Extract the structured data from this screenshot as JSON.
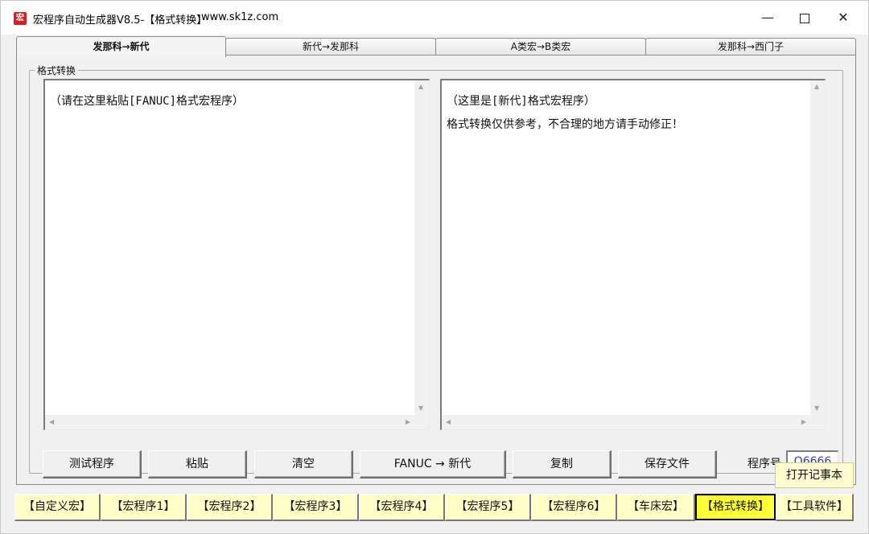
{
  "window": {
    "icon_glyph": "宏",
    "title": "宏程序自动生成器V8.5-【格式转换】",
    "site": "www.sk1z.com",
    "min_glyph": "—",
    "close_glyph": "✕"
  },
  "tabs": [
    {
      "label": "发那科→新代",
      "active": true
    },
    {
      "label": "新代→发那科",
      "active": false
    },
    {
      "label": "A类宏→B类宏",
      "active": false
    },
    {
      "label": "发那科→西门子",
      "active": false
    }
  ],
  "group": {
    "title": "格式转换"
  },
  "left_text": "（请在这里粘贴[FANUC]格式宏程序）",
  "right_text": "（这里是[新代]格式宏程序）\n格式转换仅供参考，不合理的地方请手动修正！",
  "buttons": {
    "test": "测试程序",
    "paste": "粘贴",
    "clear": "清空",
    "convert": "FANUC → 新代",
    "copy": "复制",
    "save": "保存文件"
  },
  "program_number": {
    "label": "程序号",
    "value": "O6666"
  },
  "notepad_button": "打开记事本",
  "bottom_tabs": [
    {
      "label": "【自定义宏】",
      "active": false
    },
    {
      "label": "【宏程序1】",
      "active": false
    },
    {
      "label": "【宏程序2】",
      "active": false
    },
    {
      "label": "【宏程序3】",
      "active": false
    },
    {
      "label": "【宏程序4】",
      "active": false
    },
    {
      "label": "【宏程序5】",
      "active": false
    },
    {
      "label": "【宏程序6】",
      "active": false
    },
    {
      "label": "【车床宏】",
      "active": false
    },
    {
      "label": "【格式转换】",
      "active": true
    },
    {
      "label": "【工具软件】",
      "active": false
    }
  ],
  "colors": {
    "bottom_tab_bg": "#ffffc8",
    "active_bottom_tab_bg": "#ffff33",
    "program_number_color": "#2a3fc4"
  }
}
